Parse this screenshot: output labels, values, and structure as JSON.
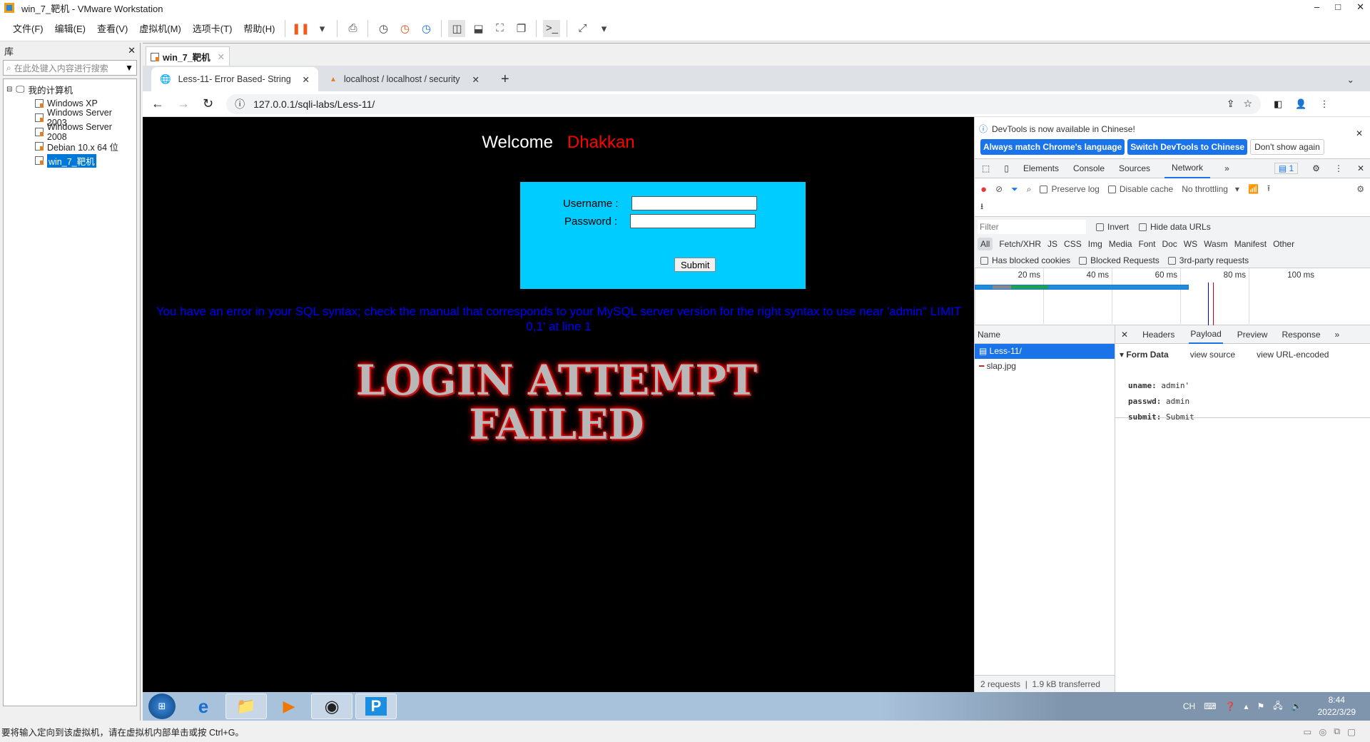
{
  "window": {
    "title": "win_7_靶机 - VMware Workstation",
    "controls": [
      "–",
      "□",
      "✕"
    ]
  },
  "menu": [
    "文件(F)",
    "编辑(E)",
    "查看(V)",
    "虚拟机(M)",
    "选项卡(T)",
    "帮助(H)"
  ],
  "library": {
    "title": "库",
    "close": "✕",
    "search_placeholder": "在此处键入内容进行搜索",
    "root": "我的计算机",
    "items": [
      "Windows XP",
      "Windows Server 2003",
      "Windows Server 2008",
      "Debian 10.x 64 位",
      "win_7_靶机"
    ]
  },
  "vm_tab": {
    "label": "win_7_靶机",
    "close": "✕"
  },
  "chrome": {
    "tabs": [
      {
        "title": "Less-11- Error Based- String",
        "close": "✕"
      },
      {
        "title": "localhost / localhost / security",
        "close": "✕"
      }
    ],
    "new_tab": "+",
    "url": "127.0.0.1/sqli-labs/Less-11/"
  },
  "page": {
    "welcome": "Welcome",
    "name": "Dhakkan",
    "username_label": "Username :",
    "password_label": "Password :",
    "submit": "Submit",
    "error": "You have an error in your SQL syntax; check the manual that corresponds to your MySQL server version for the right syntax to use near 'admin'' LIMIT 0,1' at line 1",
    "failed_image_text": "LOGIN ATTEMPT FAILED",
    "colors": {
      "form_bg": "#00ccff",
      "error": "#0000ff",
      "name": "#ff0000"
    }
  },
  "devtools": {
    "notice": "DevTools is now available in Chinese!",
    "btn_match": "Always match Chrome's language",
    "btn_switch": "Switch DevTools to Chinese",
    "btn_dont": "Don't show again",
    "tabs": [
      "Elements",
      "Console",
      "Sources",
      "Network"
    ],
    "active_tab": "Network",
    "issues": "1",
    "preserve_log": "Preserve log",
    "disable_cache": "Disable cache",
    "throttling": "No throttling",
    "filter_placeholder": "Filter",
    "invert": "Invert",
    "hide_data_urls": "Hide data URLs",
    "types": [
      "All",
      "Fetch/XHR",
      "JS",
      "CSS",
      "Img",
      "Media",
      "Font",
      "Doc",
      "WS",
      "Wasm",
      "Manifest",
      "Other"
    ],
    "blocked_cookies": "Has blocked cookies",
    "blocked_requests": "Blocked Requests",
    "third_party": "3rd-party requests",
    "timeline_ticks": [
      "20 ms",
      "40 ms",
      "60 ms",
      "80 ms",
      "100 ms"
    ],
    "name_header": "Name",
    "requests": [
      "Less-11/",
      "slap.jpg"
    ],
    "detail_tabs": [
      "Headers",
      "Payload",
      "Preview",
      "Response"
    ],
    "active_detail": "Payload",
    "form_data": "Form Data",
    "view_source": "view source",
    "view_url_encoded": "view URL-encoded",
    "fields": [
      {
        "k": "uname:",
        "v": "admin'"
      },
      {
        "k": "passwd:",
        "v": "admin"
      },
      {
        "k": "submit:",
        "v": "Submit"
      }
    ],
    "summary": [
      "2 requests",
      "1.9 kB transferred"
    ]
  },
  "taskbar": {
    "lang": "CH",
    "time": "8:44",
    "date": "2022/3/29"
  },
  "status": "要将输入定向到该虚拟机，请在虚拟机内部单击或按 Ctrl+G。"
}
